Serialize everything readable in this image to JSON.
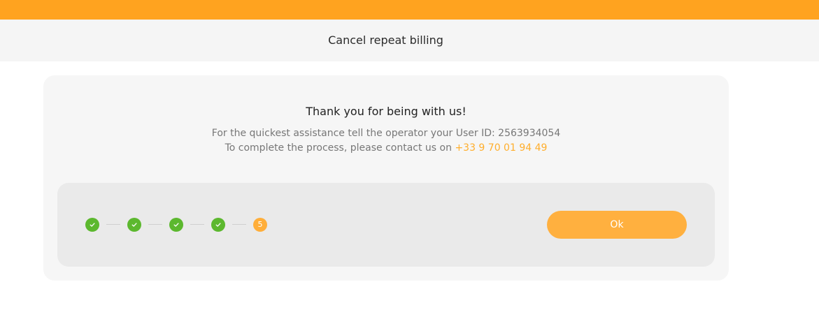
{
  "header": {
    "title": "Cancel repeat billing"
  },
  "card": {
    "heading": "Thank you for being with us!",
    "assistance_text": "For the quickest assistance tell the operator your User ID: 2563934054",
    "contact_text": "To complete the process, please contact us on ",
    "phone": "+33 9 70 01 94 49"
  },
  "progress": {
    "steps": [
      {
        "status": "done",
        "icon": "check-icon"
      },
      {
        "status": "done",
        "icon": "check-icon"
      },
      {
        "status": "done",
        "icon": "check-icon"
      },
      {
        "status": "done",
        "icon": "check-icon"
      },
      {
        "status": "current",
        "label": "5"
      }
    ]
  },
  "actions": {
    "ok_label": "Ok"
  },
  "colors": {
    "brand_orange": "#ffa31f",
    "step_done_green": "#5cb82e",
    "step_current_orange": "#ffae3a",
    "link_orange": "#ffae2c"
  }
}
